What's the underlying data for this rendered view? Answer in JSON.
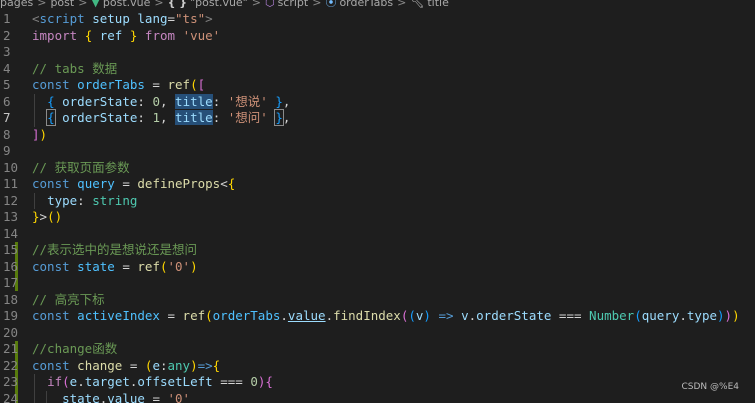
{
  "breadcrumb": {
    "items": [
      "pages",
      "post",
      "post.vue",
      "\"post.vue\"",
      "script",
      "orderTabs",
      "title"
    ],
    "separator": ">"
  },
  "editor": {
    "line_numbers": [
      "1",
      "2",
      "3",
      "4",
      "5",
      "6",
      "7",
      "8",
      "9",
      "10",
      "11",
      "12",
      "13",
      "14",
      "15",
      "16",
      "17",
      "18",
      "19",
      "20",
      "21",
      "22",
      "23",
      "24"
    ],
    "active_line": "7",
    "lines": [
      [
        [
          "t-tag",
          "<"
        ],
        [
          "t-tagname",
          "script"
        ],
        [
          "t-plain",
          " "
        ],
        [
          "t-attr",
          "setup"
        ],
        [
          "t-plain",
          " "
        ],
        [
          "t-attr",
          "lang"
        ],
        [
          "t-plain",
          "="
        ],
        [
          "t-str",
          "\"ts\""
        ],
        [
          "t-tag",
          ">"
        ]
      ],
      [
        [
          "t-kw",
          "import"
        ],
        [
          "t-plain",
          " "
        ],
        [
          "b1",
          "{"
        ],
        [
          "t-plain",
          " "
        ],
        [
          "t-prop",
          "ref"
        ],
        [
          "t-plain",
          " "
        ],
        [
          "b1",
          "}"
        ],
        [
          "t-plain",
          " "
        ],
        [
          "t-kw",
          "from"
        ],
        [
          "t-plain",
          " "
        ],
        [
          "t-str",
          "'vue'"
        ]
      ],
      [],
      [
        [
          "t-com",
          "// tabs 数据"
        ]
      ],
      [
        [
          "t-decl",
          "const"
        ],
        [
          "t-plain",
          " "
        ],
        [
          "t-var",
          "orderTabs"
        ],
        [
          "t-plain",
          " = "
        ],
        [
          "t-fn",
          "ref"
        ],
        [
          "b1",
          "("
        ],
        [
          "b2",
          "["
        ]
      ],
      [
        [
          "t-plain",
          "  "
        ],
        [
          "b3",
          "{"
        ],
        [
          "t-plain",
          " "
        ],
        [
          "t-prop",
          "orderState"
        ],
        [
          "t-plain",
          ": "
        ],
        [
          "t-num",
          "0"
        ],
        [
          "t-plain",
          ", "
        ],
        [
          "t-prop hl",
          "title"
        ],
        [
          "t-plain",
          ": "
        ],
        [
          "t-str",
          "'想说'"
        ],
        [
          "t-plain",
          " "
        ],
        [
          "b3",
          "}"
        ],
        [
          "t-plain",
          ","
        ]
      ],
      [
        [
          "t-plain",
          "  "
        ],
        [
          "b3 bracket-box",
          "{"
        ],
        [
          "t-plain",
          " "
        ],
        [
          "t-prop",
          "orderState"
        ],
        [
          "t-plain",
          ": "
        ],
        [
          "t-num",
          "1"
        ],
        [
          "t-plain",
          ", "
        ],
        [
          "t-prop hl",
          "title"
        ],
        [
          "t-plain",
          ": "
        ],
        [
          "t-str",
          "'想问'"
        ],
        [
          "t-plain",
          " "
        ],
        [
          "b3 bracket-box",
          "}"
        ],
        [
          "t-plain",
          ","
        ]
      ],
      [
        [
          "b2",
          "]"
        ],
        [
          "b1",
          ")"
        ]
      ],
      [],
      [
        [
          "t-com",
          "// 获取页面参数"
        ]
      ],
      [
        [
          "t-decl",
          "const"
        ],
        [
          "t-plain",
          " "
        ],
        [
          "t-var",
          "query"
        ],
        [
          "t-plain",
          " = "
        ],
        [
          "t-fn",
          "defineProps"
        ],
        [
          "t-plain",
          "<"
        ],
        [
          "b1",
          "{"
        ]
      ],
      [
        [
          "t-plain",
          "  "
        ],
        [
          "t-prop",
          "type"
        ],
        [
          "t-plain",
          ": "
        ],
        [
          "t-type",
          "string"
        ]
      ],
      [
        [
          "b1",
          "}"
        ],
        [
          "t-plain",
          ">"
        ],
        [
          "b1",
          "()"
        ]
      ],
      [],
      [
        [
          "t-com",
          "//表示选中的是想说还是想问"
        ]
      ],
      [
        [
          "t-decl",
          "const"
        ],
        [
          "t-plain",
          " "
        ],
        [
          "t-var",
          "state"
        ],
        [
          "t-plain",
          " = "
        ],
        [
          "t-fn",
          "ref"
        ],
        [
          "b1",
          "("
        ],
        [
          "t-str",
          "'0'"
        ],
        [
          "b1",
          ")"
        ]
      ],
      [],
      [
        [
          "t-com",
          "// 高亮下标"
        ]
      ],
      [
        [
          "t-decl",
          "const"
        ],
        [
          "t-plain",
          " "
        ],
        [
          "t-var",
          "activeIndex"
        ],
        [
          "t-plain",
          " = "
        ],
        [
          "t-fn",
          "ref"
        ],
        [
          "b1",
          "("
        ],
        [
          "t-var",
          "orderTabs"
        ],
        [
          "t-plain",
          "."
        ],
        [
          "t-prop u",
          "value"
        ],
        [
          "t-plain",
          "."
        ],
        [
          "t-fn",
          "findIndex"
        ],
        [
          "b2",
          "("
        ],
        [
          "b3",
          "("
        ],
        [
          "t-prop",
          "v"
        ],
        [
          "b3",
          ")"
        ],
        [
          "t-plain",
          " "
        ],
        [
          "t-decl",
          "=>"
        ],
        [
          "t-plain",
          " "
        ],
        [
          "t-prop",
          "v"
        ],
        [
          "t-plain",
          "."
        ],
        [
          "t-prop",
          "orderState"
        ],
        [
          "t-plain",
          " === "
        ],
        [
          "t-type",
          "Number"
        ],
        [
          "b3",
          "("
        ],
        [
          "t-prop",
          "query"
        ],
        [
          "t-plain",
          "."
        ],
        [
          "t-prop",
          "type"
        ],
        [
          "b3",
          ")"
        ],
        [
          "b2",
          ")"
        ],
        [
          "b1",
          ")"
        ]
      ],
      [],
      [
        [
          "t-com",
          "//change函数"
        ]
      ],
      [
        [
          "t-decl",
          "const"
        ],
        [
          "t-plain",
          " "
        ],
        [
          "t-fn",
          "change"
        ],
        [
          "t-plain",
          " = "
        ],
        [
          "b1",
          "("
        ],
        [
          "t-prop",
          "e"
        ],
        [
          "t-plain",
          ":"
        ],
        [
          "t-type",
          "any"
        ],
        [
          "b1",
          ")"
        ],
        [
          "t-decl",
          "=>"
        ],
        [
          "b1",
          "{"
        ]
      ],
      [
        [
          "t-plain",
          "  "
        ],
        [
          "t-kw",
          "if"
        ],
        [
          "b2",
          "("
        ],
        [
          "t-prop",
          "e"
        ],
        [
          "t-plain",
          "."
        ],
        [
          "t-prop",
          "target"
        ],
        [
          "t-plain",
          "."
        ],
        [
          "t-prop",
          "offsetLeft"
        ],
        [
          "t-plain",
          " === "
        ],
        [
          "t-num",
          "0"
        ],
        [
          "b2",
          ")"
        ],
        [
          "b2",
          "{"
        ]
      ],
      [
        [
          "t-plain",
          "    "
        ],
        [
          "t-prop",
          "state"
        ],
        [
          "t-plain",
          "."
        ],
        [
          "t-prop",
          "value"
        ],
        [
          "t-plain",
          " = "
        ],
        [
          "t-str",
          "'0'"
        ]
      ]
    ]
  },
  "watermark": "CSDN @%E4"
}
